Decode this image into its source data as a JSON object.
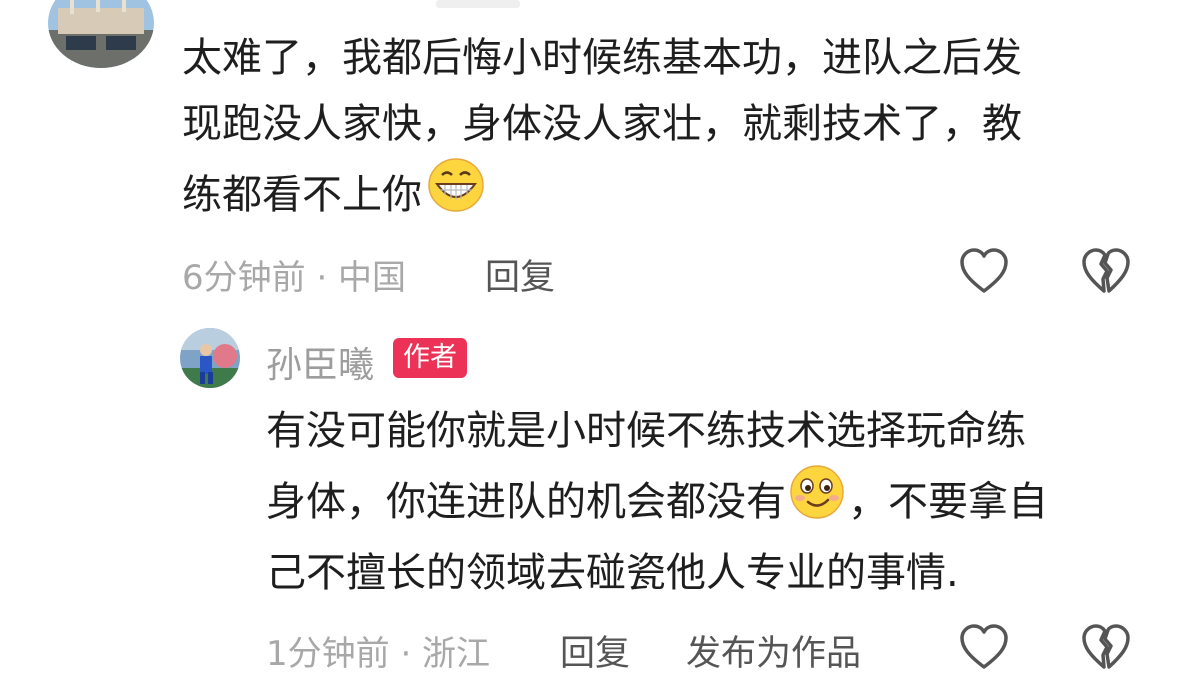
{
  "colors": {
    "author_badge_bg": "#ec3257",
    "meta_text": "#a8a8a8",
    "body_text": "#1e1e1e",
    "icon_stroke": "#555555"
  },
  "comment": {
    "lines": [
      "太难了，我都后悔小时候练基本功，进队之后发",
      "现跑没人家快，身体没人家壮，就剩技术了，教",
      "练都看不上你"
    ],
    "emoji": "grin-emoji",
    "time_location": "6分钟前 · 中国",
    "reply_label": "回复",
    "like_icon": "heart-outline-icon",
    "dislike_icon": "broken-heart-icon"
  },
  "reply": {
    "author": "孙臣曦",
    "badge": "作者",
    "lines": [
      "有没可能你就是小时候不练技术选择玩命练",
      [
        "身体，你连进队的机会都没有",
        "，不要拿自"
      ],
      "己不擅长的领域去碰瓷他人专业的事情."
    ],
    "line1": "有没可能你就是小时候不练技术选择玩命练",
    "line2a": "身体，你连进队的机会都没有",
    "line2b": "，不要拿自",
    "line3": "己不擅长的领域去碰瓷他人专业的事情.",
    "emoji": "smirk-emoji",
    "time_location": "1分钟前 · 浙江",
    "reply_label": "回复",
    "publish_label": "发布为作品",
    "like_icon": "heart-outline-icon",
    "dislike_icon": "broken-heart-icon"
  }
}
